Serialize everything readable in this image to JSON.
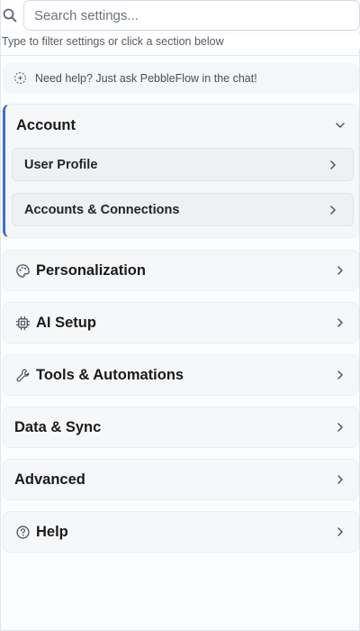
{
  "search": {
    "placeholder": "Search settings...",
    "hint": "Type to filter settings or click a section below"
  },
  "help_banner": {
    "text": "Need help? Just ask PebbleFlow in the chat!",
    "icon": "sparkle-dashed-circle-icon"
  },
  "sections": {
    "account": {
      "title": "Account",
      "expanded": true,
      "items": [
        {
          "label": "User Profile"
        },
        {
          "label": "Accounts & Connections"
        }
      ]
    },
    "personalization": {
      "title": "Personalization",
      "icon": "palette-icon"
    },
    "ai_setup": {
      "title": "AI Setup",
      "icon": "cpu-chip-icon"
    },
    "tools": {
      "title": "Tools & Automations",
      "icon": "wrench-icon"
    },
    "data_sync": {
      "title": "Data & Sync"
    },
    "advanced": {
      "title": "Advanced"
    },
    "help": {
      "title": "Help",
      "icon": "question-circle-icon"
    }
  },
  "colors": {
    "accent": "#3b6fd4",
    "section_bg": "#f6f7f9",
    "subitem_bg": "#eef0f3"
  }
}
